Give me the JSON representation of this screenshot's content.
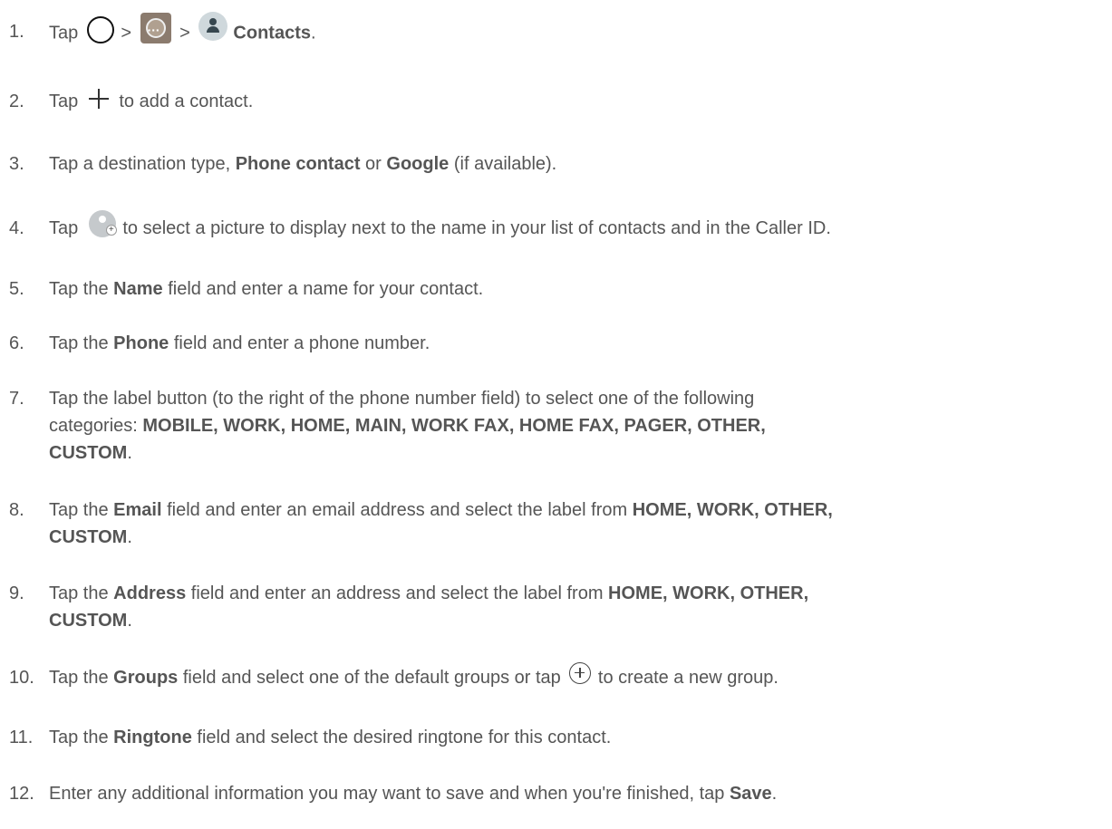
{
  "steps": [
    {
      "num": "1.",
      "a": "Tap ",
      "sep1": " > ",
      "sep2": " > ",
      "bold": "Contacts",
      "end": ".",
      "icons": [
        "home-circle-icon",
        "apps-icon",
        "contacts-app-icon"
      ]
    },
    {
      "num": "2.",
      "a": "Tap ",
      "b": " to add a contact.",
      "icons": [
        "plus-icon"
      ]
    },
    {
      "num": "3.",
      "a": "Tap a destination type, ",
      "bold1": "Phone contact",
      "mid": " or ",
      "bold2": "Google",
      "end": " (if available)."
    },
    {
      "num": "4.",
      "a": "Tap ",
      "b": " to select a picture to display next to the name in your list of contacts and in the Caller ID.",
      "icons": [
        "add-photo-icon"
      ]
    },
    {
      "num": "5.",
      "a": "Tap the ",
      "bold": "Name",
      "end": " field and enter a name for your contact."
    },
    {
      "num": "6.",
      "a": "Tap the ",
      "bold": "Phone",
      "end": " field and enter a phone number."
    },
    {
      "num": "7.",
      "line1": "Tap the label button (to the right of the phone number field) to select one of the following",
      "a": "categories: ",
      "bold": "MOBILE, WORK, HOME, MAIN, WORK FAX, HOME FAX, PAGER, OTHER,",
      "bold2": "CUSTOM",
      "end": "."
    },
    {
      "num": "8.",
      "a": "Tap the ",
      "bold": "Email",
      "mid": " field and enter an email address and select the label from ",
      "bold2": "HOME, WORK, OTHER,",
      "bold3": "CUSTOM",
      "end": "."
    },
    {
      "num": "9.",
      "a": "Tap the ",
      "bold": "Address",
      "mid": " field and enter an address and select the label from ",
      "bold2": "HOME, WORK, OTHER,",
      "bold3": "CUSTOM",
      "end": "."
    },
    {
      "num": "10.",
      "a": "Tap the ",
      "bold": "Groups",
      "mid": " field and select one of the default groups or tap ",
      "end": " to create a new group.",
      "icons": [
        "add-group-icon"
      ]
    },
    {
      "num": "11.",
      "a": "Tap the ",
      "bold": "Ringtone",
      "end": " field and select the desired ringtone for this contact."
    },
    {
      "num": "12.",
      "a": "Enter any additional information you may want to save and when you're finished, tap ",
      "bold": "Save",
      "end": "."
    }
  ]
}
